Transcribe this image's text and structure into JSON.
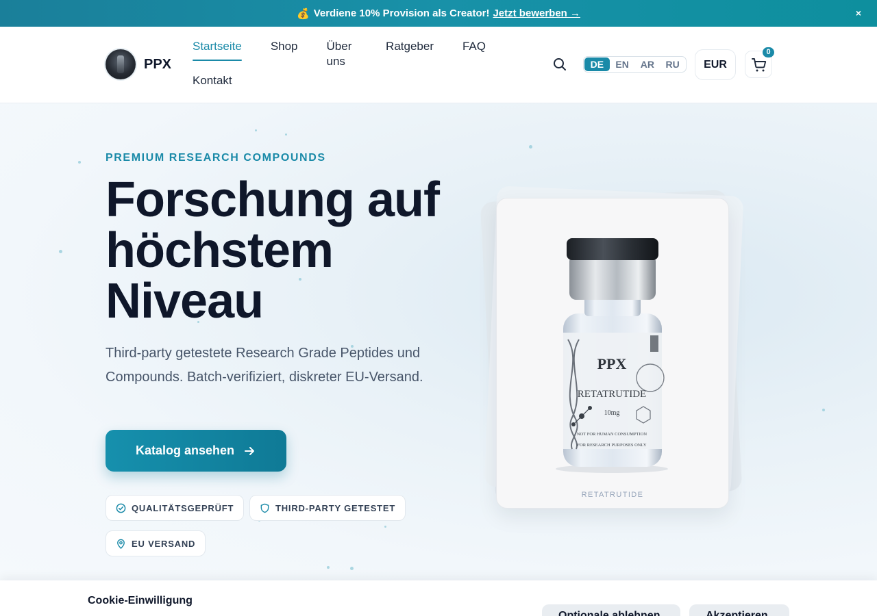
{
  "promo": {
    "text": "Verdiene 10% Provision als Creator!",
    "link": "Jetzt bewerben →",
    "coin_icon": "💰",
    "close_label": "×"
  },
  "header": {
    "brand": "PPX",
    "nav": [
      "Startseite",
      "Shop",
      "Über uns",
      "Ratgeber",
      "FAQ",
      "Kontakt"
    ],
    "languages": [
      "DE",
      "EN",
      "AR",
      "RU"
    ],
    "active_language": "DE",
    "currency": "EUR",
    "cart_count": "0",
    "accent": "#1a8aa8"
  },
  "hero": {
    "eyebrow": "PREMIUM RESEARCH COMPOUNDS",
    "title_lines": [
      "Forschung auf",
      "höchstem",
      "Niveau"
    ],
    "lead": "Third-party getestete Research Grade Peptides und Compounds. Batch-verifiziert, diskreter EU-Versand.",
    "cta": "Katalog ansehen",
    "chips": [
      "QUALITÄTSGEPRÜFT",
      "THIRD-PARTY GETESTET",
      "EU VERSAND"
    ],
    "product": {
      "caption": "RETATRUTIDE",
      "vial_brand": "PPX",
      "vial_name": "RETATRUTIDE",
      "vial_dose": "10mg",
      "vial_warn_1": "NOT FOR HUMAN CONSUMPTION",
      "vial_warn_2": "FOR RESEARCH PURPOSES ONLY"
    }
  },
  "cookie": {
    "title": "Cookie-Einwilligung",
    "buttons": [
      "Optionale ablehnen",
      "Akzeptieren"
    ]
  }
}
